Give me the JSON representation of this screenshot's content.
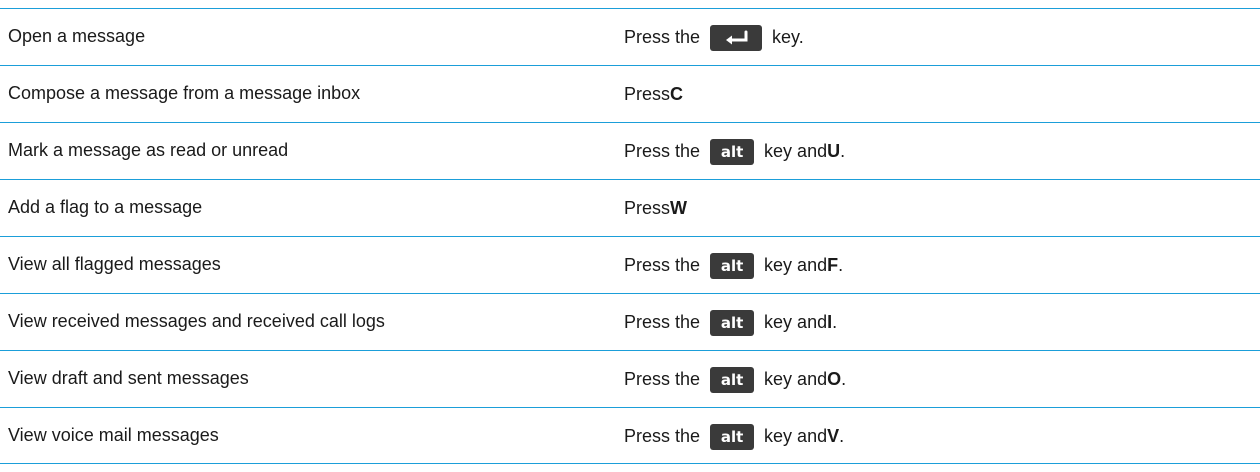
{
  "rows": [
    {
      "action": "Open a message",
      "pre": "Press the",
      "key": "enter",
      "post": "key."
    },
    {
      "action": "Compose a message from a message inbox",
      "pre": "Press",
      "letter": "C"
    },
    {
      "action": "Mark a message as read or unread",
      "pre": "Press the",
      "key": "alt",
      "post": "key and",
      "letter": "U",
      "end": "."
    },
    {
      "action": "Add a flag to a message",
      "pre": "Press",
      "letter": "W"
    },
    {
      "action": "View all flagged messages",
      "pre": "Press the",
      "key": "alt",
      "post": "key and",
      "letter": "F",
      "end": "."
    },
    {
      "action": "View received messages and received call logs",
      "pre": "Press the",
      "key": "alt",
      "post": "key and",
      "letter": "I",
      "end": "."
    },
    {
      "action": "View draft and sent messages",
      "pre": "Press the",
      "key": "alt",
      "post": "key and",
      "letter": "O",
      "end": "."
    },
    {
      "action": "View voice mail messages",
      "pre": "Press the",
      "key": "alt",
      "post": "key and",
      "letter": "V",
      "end": "."
    }
  ],
  "keys": {
    "alt_label": "alt",
    "enter_icon": "enter-key-icon"
  },
  "colors": {
    "rule": "#1b9ed9",
    "key_bg": "#3a3a3a",
    "key_fg": "#ffffff"
  }
}
